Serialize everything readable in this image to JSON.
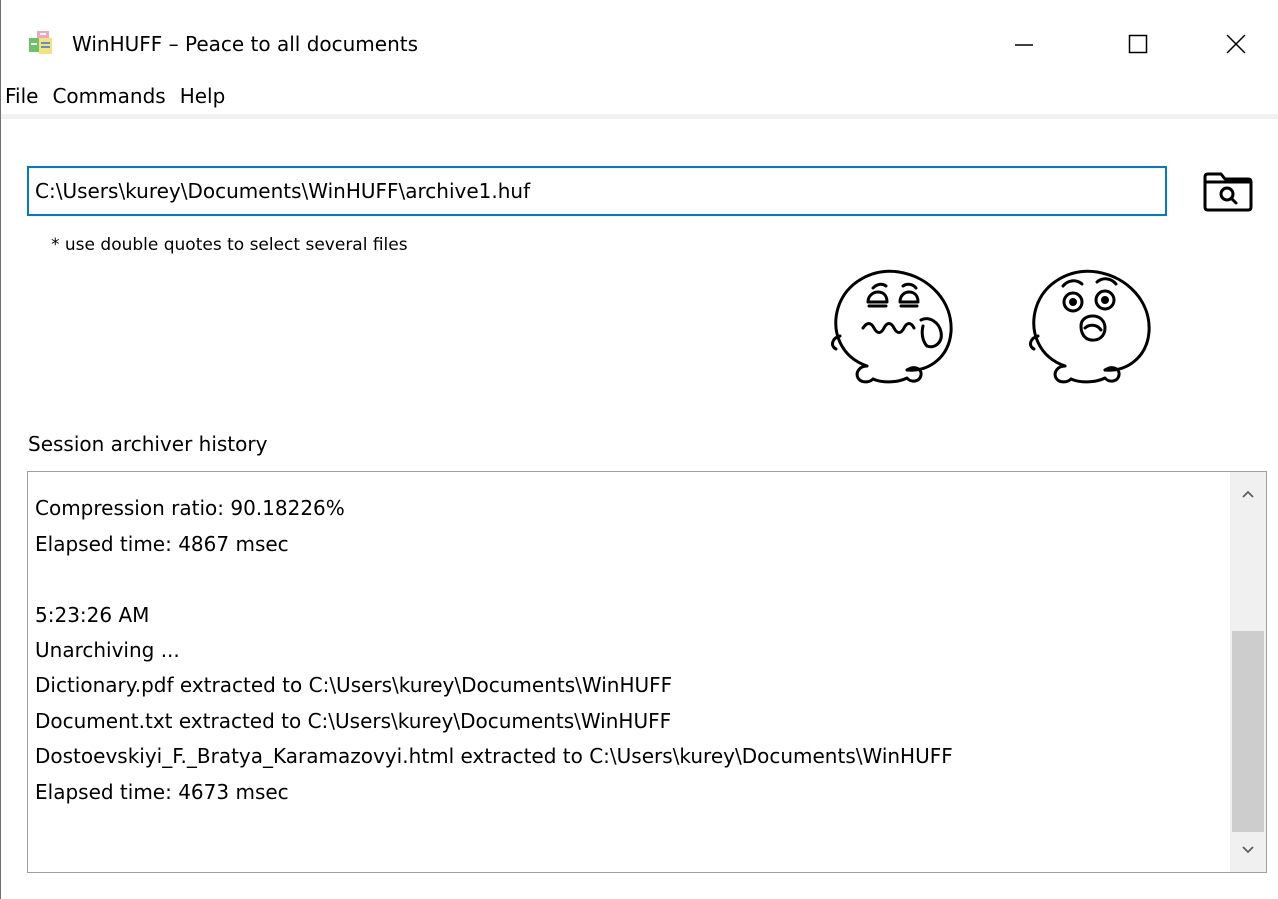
{
  "window": {
    "title": "WinHUFF – Peace to all documents",
    "app_icon": "winhuff-app-icon",
    "controls": {
      "minimize_icon": "minimize-icon",
      "maximize_icon": "maximize-icon",
      "close_icon": "close-icon"
    }
  },
  "menu": {
    "items": [
      {
        "label": "File"
      },
      {
        "label": "Commands"
      },
      {
        "label": "Help"
      }
    ]
  },
  "path": {
    "value": "C:\\Users\\kurey\\Documents\\WinHUFF\\archive1.huf",
    "browse_icon": "folder-search-icon",
    "hint": "* use double quotes to select several files"
  },
  "actions": {
    "archive_icon": "squeezed-face-icon",
    "unarchive_icon": "surprised-face-icon"
  },
  "history": {
    "label": "Session archiver history",
    "lines": [
      "Compression ratio: 90.18226%",
      "Elapsed time: 4867 msec",
      "",
      "5:23:26 AM",
      "Unarchiving ...",
      "Dictionary.pdf extracted to C:\\Users\\kurey\\Documents\\WinHUFF",
      "Document.txt extracted to C:\\Users\\kurey\\Documents\\WinHUFF",
      "Dostoevskiyi_F._Bratya_Karamazovyi.html extracted to C:\\Users\\kurey\\Documents\\WinHUFF",
      "Elapsed time: 4673 msec"
    ],
    "scroll_position": 0.92
  },
  "colors": {
    "focus_border": "#0078d7",
    "scrollbar_track": "#f0f0f0",
    "scrollbar_thumb": "#cdcdcd"
  }
}
